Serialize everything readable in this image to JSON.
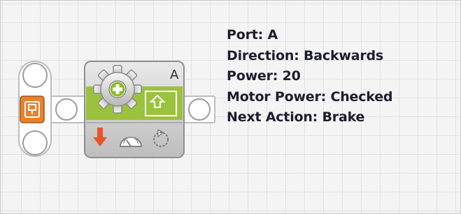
{
  "block": {
    "port_label": "A",
    "direction_arrow_color": "#e8542a",
    "accent_green": "#9bc23c",
    "icons": [
      "gear-icon",
      "direction-arrow-icon",
      "speed-dial-icon",
      "next-action-icon",
      "sequence-beam-icon"
    ]
  },
  "config": {
    "port": "Port: A",
    "direction": "Direction: Backwards",
    "power": "Power: 20",
    "motor_power": "Motor Power: Checked",
    "next_action": "Next Action: Brake"
  }
}
